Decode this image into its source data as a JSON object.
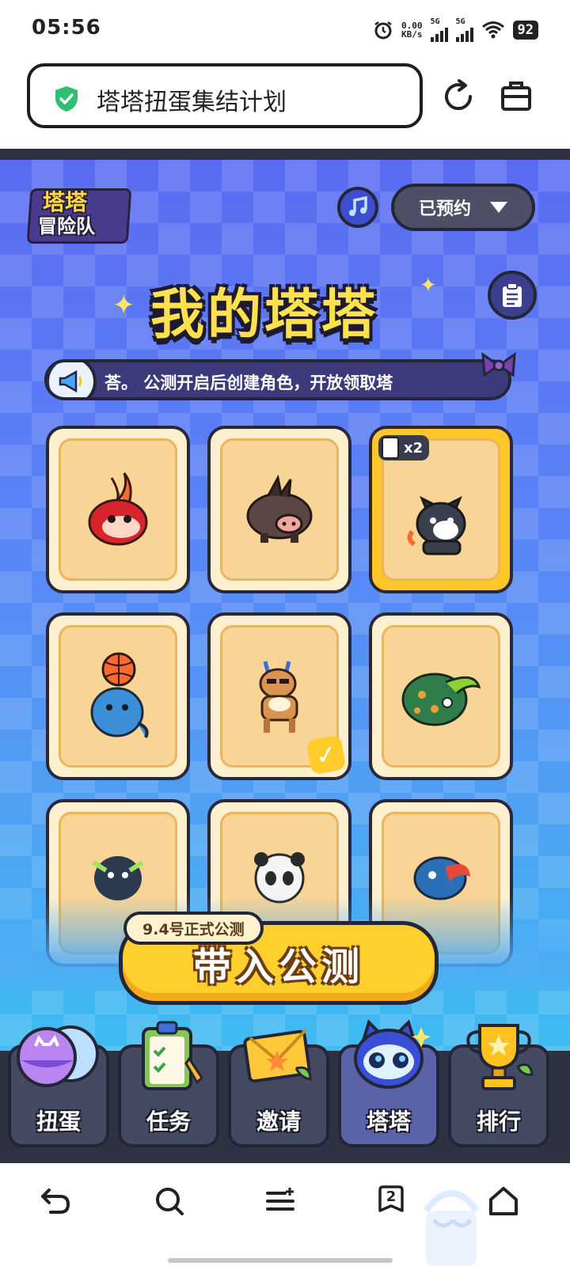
{
  "status_bar": {
    "time": "05:56",
    "net_speed_top": "0.00",
    "net_speed_bottom": "KB/s",
    "signal1": "5G",
    "signal2": "5G",
    "battery": "92",
    "icons": [
      "alarm-icon",
      "signal-icon",
      "signal-icon",
      "wifi-icon",
      "battery-icon"
    ]
  },
  "browser": {
    "page_title": "塔塔扭蛋集结计划",
    "secure_icon": "shield-check-icon",
    "reload_icon": "reload-icon",
    "toolbox_icon": "toolbox-icon"
  },
  "game": {
    "logo": {
      "line1": "塔塔",
      "line2": "冒险队"
    },
    "music_icon": "music-note-icon",
    "reserve_label": "已预约",
    "title": "我的塔塔",
    "clipboard_icon": "clipboard-icon",
    "marquee_text": "荅。          公测开启后创建角色，开放领取塔",
    "cards": [
      {
        "name": "火焰鸟",
        "selected": false,
        "checked": false
      },
      {
        "name": "野猪",
        "selected": false,
        "checked": false
      },
      {
        "name": "柴犬",
        "selected": true,
        "checked": false,
        "count_label": "x2"
      },
      {
        "name": "篮球海豹",
        "selected": false,
        "checked": false
      },
      {
        "name": "小鹿",
        "selected": false,
        "checked": true
      },
      {
        "name": "甲虫",
        "selected": false,
        "checked": false
      },
      {
        "name": "企鹅",
        "selected": false,
        "checked": false
      },
      {
        "name": "熊猫",
        "selected": false,
        "checked": false
      },
      {
        "name": "鹦鹉",
        "selected": false,
        "checked": false
      }
    ],
    "cta_tag": "9.4号正式公测",
    "cta_label": "带入公测",
    "tabs": [
      {
        "label": "扭蛋",
        "icon": "capsule-icon",
        "active": false
      },
      {
        "label": "任务",
        "icon": "clipboard-task-icon",
        "active": false
      },
      {
        "label": "邀请",
        "icon": "envelope-icon",
        "active": false
      },
      {
        "label": "塔塔",
        "icon": "cat-mascot-icon",
        "active": true
      },
      {
        "label": "排行",
        "icon": "trophy-icon",
        "active": false
      }
    ]
  },
  "bottom_bar": {
    "back_icon": "back-icon",
    "search_icon": "search-icon",
    "menu_icon": "menu-icon",
    "tabs_icon": "tabs-icon",
    "tabs_count": "2",
    "home_icon": "home-icon"
  },
  "colors": {
    "accent_yellow": "#ffcf2e",
    "panel_dark": "#2e3242",
    "secure_green": "#2fbf71"
  }
}
